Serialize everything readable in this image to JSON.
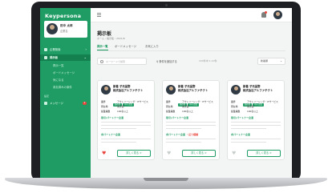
{
  "sidebar": {
    "logo": "Keypersona",
    "profile": {
      "name": "田中 太郎",
      "sub": "企業名"
    },
    "items": [
      {
        "label": "企業検索"
      },
      {
        "label": "掲示板"
      },
      {
        "label": "掲示一覧"
      },
      {
        "label": "ボードメッセージ"
      },
      {
        "label": "気になる"
      },
      {
        "label": "参加済みの案件"
      },
      {
        "label": "メッセージ",
        "badge": "3"
      }
    ],
    "section_label": "設定"
  },
  "topbar": {
    "notification_icon": "bell-icon",
    "avatar": "avatar"
  },
  "main": {
    "title": "掲示板",
    "breadcrumb": "ホーム › 掲示板 › 2021/6",
    "tabs": [
      {
        "label": "掲示一覧"
      },
      {
        "label": "ボードメッセージ"
      },
      {
        "label": "お気に入り"
      }
    ],
    "search_placeholder": "キーワードで検索",
    "filter_label": "条件を追加する",
    "result_count": "100件中 1-10件",
    "sort_label": "新着順"
  },
  "cards": [
    {
      "name": "新着 子元品野",
      "company": "株式会社アルファテクト",
      "tags": [
        "製造業",
        "中小企業"
      ],
      "rows": [
        {
          "k": "業界",
          "v": "アウトソーシング・ITサービス"
        },
        {
          "k": "所在地",
          "v": "東京都"
        },
        {
          "k": "従業員数",
          "v": "100名以上"
        }
      ],
      "section1": "取引/パートナー企業",
      "section2": "求パートナー企業",
      "section2_badge": "",
      "liked": true,
      "button": "詳しく見る >"
    },
    {
      "name": "新着 子元品野",
      "company": "株式会社アルファテクト",
      "tags": [
        "製造業",
        "中小企業"
      ],
      "rows": [
        {
          "k": "業界",
          "v": "アウトソーシング・ITサービス"
        },
        {
          "k": "所在地",
          "v": "東京都"
        },
        {
          "k": "従業員数",
          "v": "100名以上"
        }
      ],
      "section1": "取引/パートナー企業",
      "section2": "求パートナー企業",
      "section2_badge": "・反り積極",
      "liked": false,
      "button": "詳しく見る >"
    },
    {
      "name": "新着 子元品野",
      "company": "株式会社アルファテクト",
      "tags": [
        "製造業",
        "中小企業"
      ],
      "rows": [
        {
          "k": "業界",
          "v": "アウトソーシング・ITサービス"
        },
        {
          "k": "所在地",
          "v": "東京都"
        },
        {
          "k": "従業員数",
          "v": "100名以上"
        }
      ],
      "section1": "取引/パートナー企業",
      "section2": "求パートナー企業",
      "section2_badge": "",
      "liked": false,
      "button": "詳しく見る >"
    }
  ],
  "colors": {
    "brand": "#1e9c63",
    "alert": "#e8453c"
  }
}
